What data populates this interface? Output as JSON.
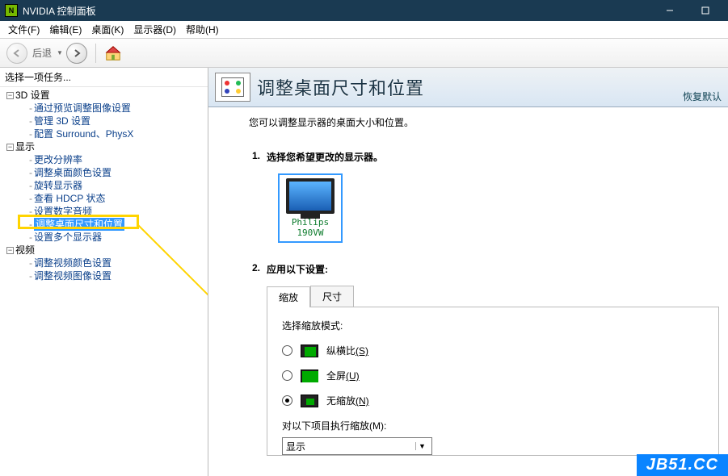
{
  "window": {
    "title": "NVIDIA 控制面板"
  },
  "menu": {
    "file": "文件(F)",
    "edit": "编辑(E)",
    "desktop": "桌面(K)",
    "display": "显示器(D)",
    "help": "帮助(H)"
  },
  "toolbar": {
    "back": "后退"
  },
  "sidebar": {
    "task_prompt": "选择一项任务...",
    "groups": [
      {
        "label": "3D 设置",
        "items": [
          "通过预览调整图像设置",
          "管理 3D 设置",
          "配置 Surround、PhysX"
        ]
      },
      {
        "label": "显示",
        "items": [
          "更改分辨率",
          "调整桌面颜色设置",
          "旋转显示器",
          "查看 HDCP 状态",
          "设置数字音频",
          "调整桌面尺寸和位置",
          "设置多个显示器"
        ]
      },
      {
        "label": "视频",
        "items": [
          "调整视频颜色设置",
          "调整视频图像设置"
        ]
      }
    ]
  },
  "content": {
    "header_title": "调整桌面尺寸和位置",
    "restore": "恢复默认",
    "description": "您可以调整显示器的桌面大小和位置。",
    "step1": {
      "num": "1.",
      "title": "选择您希望更改的显示器。",
      "monitor": "Philips 190VW"
    },
    "step2": {
      "num": "2.",
      "title": "应用以下设置:",
      "tabs": {
        "scale": "缩放",
        "size": "尺寸"
      },
      "scale_mode_label": "选择缩放模式:",
      "options": {
        "aspect": {
          "label": "纵横比",
          "hot": "(S)"
        },
        "full": {
          "label": "全屏",
          "hot": "(U)"
        },
        "noscale": {
          "label": "无缩放",
          "hot": "(N)"
        }
      },
      "selected": "noscale",
      "apply_on_label": "对以下项目执行缩放(M):",
      "apply_on_value": "显示"
    }
  },
  "watermark": "JB51.CC"
}
